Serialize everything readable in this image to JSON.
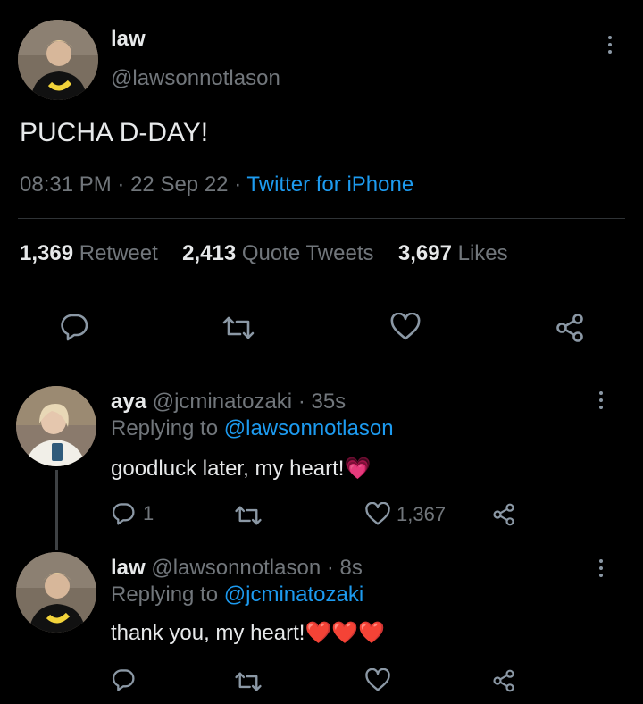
{
  "main_tweet": {
    "author_name": "law",
    "author_handle": "@lawsonnotlason",
    "text": "PUCHA D-DAY!",
    "time": "08:31 PM",
    "separator": "·",
    "date": "22 Sep 22",
    "source": "Twitter for iPhone",
    "stats": {
      "retweets_count": "1,369",
      "retweets_label": "Retweet",
      "quotes_count": "2,413",
      "quotes_label": "Quote Tweets",
      "likes_count": "3,697",
      "likes_label": "Likes"
    }
  },
  "replies": [
    {
      "name": "aya",
      "handle": "@jcminatozaki",
      "time": "· 35s",
      "replying_label": "Replying to",
      "replying_to": "@lawsonnotlason",
      "text": "goodluck later, my heart!",
      "emoji": "💗",
      "reply_count": "1",
      "like_count": "1,367"
    },
    {
      "name": "law",
      "handle": "@lawsonnotlason",
      "time": "· 8s",
      "replying_label": "Replying to",
      "replying_to": "@jcminatozaki",
      "text": "thank you, my heart!",
      "emoji": "❤️❤️❤️"
    }
  ],
  "colors": {
    "background": "#000000",
    "text": "#e7e9ea",
    "muted": "#71767b",
    "link": "#1d9bf0",
    "divider": "#2f3336"
  },
  "icons": [
    "more-icon",
    "reply-icon",
    "retweet-icon",
    "like-icon",
    "share-icon"
  ]
}
